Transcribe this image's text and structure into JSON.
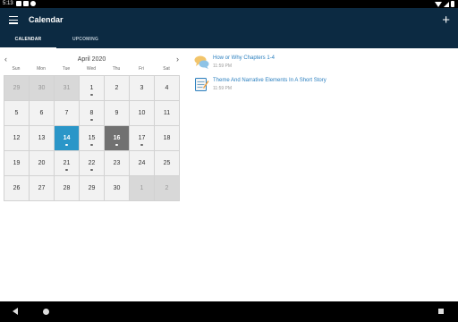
{
  "status": {
    "time": "5:13"
  },
  "appbar": {
    "title": "Calendar"
  },
  "tabs": [
    {
      "label": "CALENDAR",
      "active": true
    },
    {
      "label": "UPCOMING",
      "active": false
    }
  ],
  "calendar": {
    "month": "April 2020",
    "weekdays": [
      "Sun",
      "Mon",
      "Tue",
      "Wed",
      "Thu",
      "Fri",
      "Sat"
    ],
    "days": [
      {
        "d": "29",
        "out": true
      },
      {
        "d": "30",
        "out": true
      },
      {
        "d": "31",
        "out": true
      },
      {
        "d": "1",
        "dot": true
      },
      {
        "d": "2"
      },
      {
        "d": "3"
      },
      {
        "d": "4"
      },
      {
        "d": "5"
      },
      {
        "d": "6"
      },
      {
        "d": "7"
      },
      {
        "d": "8",
        "dot": true
      },
      {
        "d": "9"
      },
      {
        "d": "10"
      },
      {
        "d": "11"
      },
      {
        "d": "12"
      },
      {
        "d": "13"
      },
      {
        "d": "14",
        "today": true,
        "dot": true
      },
      {
        "d": "15",
        "dot": true
      },
      {
        "d": "16",
        "selected": true,
        "dot": true
      },
      {
        "d": "17",
        "dot": true
      },
      {
        "d": "18"
      },
      {
        "d": "19"
      },
      {
        "d": "20"
      },
      {
        "d": "21",
        "dot": true
      },
      {
        "d": "22",
        "dot": true
      },
      {
        "d": "23"
      },
      {
        "d": "24"
      },
      {
        "d": "25"
      },
      {
        "d": "26"
      },
      {
        "d": "27"
      },
      {
        "d": "28"
      },
      {
        "d": "29"
      },
      {
        "d": "30"
      },
      {
        "d": "1",
        "out": true
      },
      {
        "d": "2",
        "out": true
      }
    ]
  },
  "events": [
    {
      "title": "How or Why Chapters 1-4",
      "time": "11:59 PM",
      "icon": "discussion-icon"
    },
    {
      "title": "Theme And Narrative Elements In A Short Story",
      "time": "11:59 PM",
      "icon": "assignment-icon"
    }
  ],
  "colors": {
    "appbar": "#0c2a42",
    "today": "#2a96c8",
    "selected": "#717171",
    "link": "#2a7fbf"
  }
}
